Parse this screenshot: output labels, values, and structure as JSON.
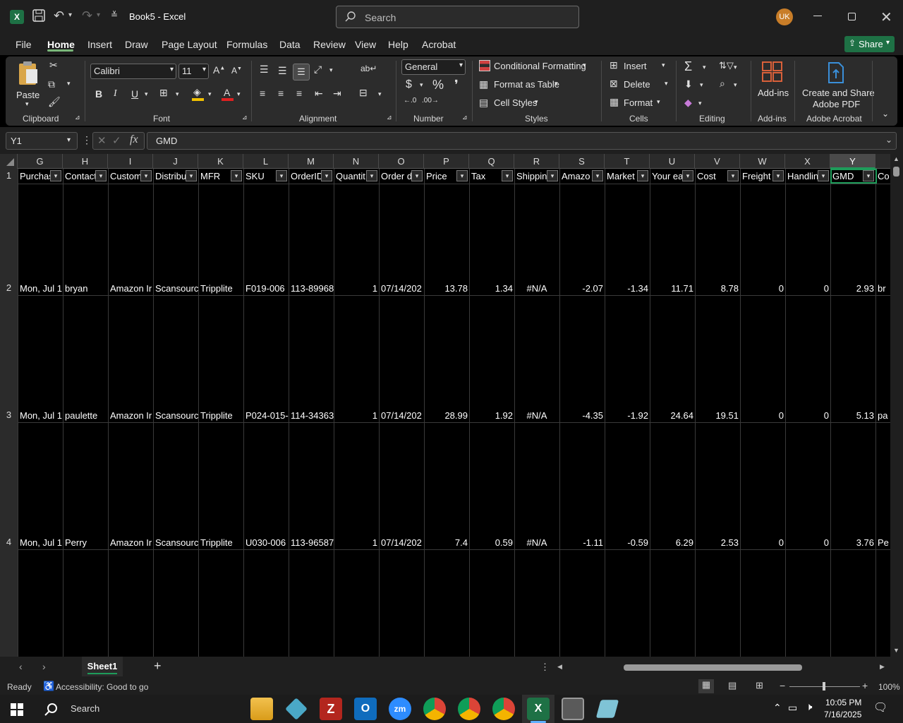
{
  "window": {
    "title": "Book5  -  Excel",
    "search_placeholder": "Search",
    "user_initials": "UK"
  },
  "ribbon_tabs": [
    "File",
    "Home",
    "Insert",
    "Draw",
    "Page Layout",
    "Formulas",
    "Data",
    "Review",
    "View",
    "Help",
    "Acrobat"
  ],
  "active_tab": "Home",
  "share_label": "Share",
  "ribbon": {
    "clipboard": {
      "paste": "Paste",
      "label": "Clipboard"
    },
    "font": {
      "name": "Calibri",
      "size": "11",
      "label": "Font"
    },
    "alignment": {
      "label": "Alignment"
    },
    "number": {
      "format": "General",
      "label": "Number"
    },
    "styles": {
      "conditional": "Conditional Formatting",
      "format_table": "Format as Table",
      "cell_styles": "Cell Styles",
      "label": "Styles"
    },
    "cells": {
      "insert": "Insert",
      "delete": "Delete",
      "format": "Format",
      "label": "Cells"
    },
    "editing": {
      "label": "Editing"
    },
    "addins": {
      "button": "Add-ins",
      "label": "Add-ins"
    },
    "acrobat": {
      "button_line1": "Create and Share",
      "button_line2": "Adobe PDF",
      "label": "Adobe Acrobat"
    }
  },
  "formula_bar": {
    "name_box": "Y1",
    "content": "GMD"
  },
  "columns": [
    "G",
    "H",
    "I",
    "J",
    "K",
    "L",
    "M",
    "N",
    "O",
    "P",
    "Q",
    "R",
    "S",
    "T",
    "U",
    "V",
    "W",
    "X",
    "Y"
  ],
  "selected_column": "Y",
  "header_row": [
    "Purchas",
    "Contact",
    "Custom",
    "Distribu",
    "MFR",
    "SKU",
    "OrderID",
    "Quantit",
    "Order d",
    "Price",
    "Tax",
    "Shippin",
    "Amazo",
    "Market",
    "Your ea",
    "Cost",
    "Freight",
    "Handlin",
    "GMD",
    "Co"
  ],
  "rows": [
    {
      "num": "2",
      "cells": [
        "Mon, Jul 1",
        "bryan",
        "Amazon Ir",
        "Scansourc",
        "Tripplite",
        "F019-006",
        "113-89968",
        "1",
        "07/14/202",
        "13.78",
        "1.34",
        "#N/A",
        "-2.07",
        "-1.34",
        "11.71",
        "8.78",
        "0",
        "0",
        "2.93",
        "br"
      ]
    },
    {
      "num": "3",
      "cells": [
        "Mon, Jul 1",
        "paulette",
        "Amazon Ir",
        "Scansourc",
        "Tripplite",
        "P024-015-",
        "114-34363",
        "1",
        "07/14/202",
        "28.99",
        "1.92",
        "#N/A",
        "-4.35",
        "-1.92",
        "24.64",
        "19.51",
        "0",
        "0",
        "5.13",
        "pa"
      ]
    },
    {
      "num": "4",
      "cells": [
        "Mon, Jul 1",
        "Perry",
        "Amazon Ir",
        "Scansourc",
        "Tripplite",
        "U030-006",
        "113-96587",
        "1",
        "07/14/202",
        "7.4",
        "0.59",
        "#N/A",
        "-1.11",
        "-0.59",
        "6.29",
        "2.53",
        "0",
        "0",
        "3.76",
        "Pe"
      ]
    }
  ],
  "header_row_num": "1",
  "sheet_tab": "Sheet1",
  "status": {
    "ready": "Ready",
    "accessibility": "Accessibility: Good to go",
    "zoom": "100%"
  },
  "taskbar": {
    "search": "Search",
    "time": "10:05 PM",
    "date": "7/16/2025"
  }
}
